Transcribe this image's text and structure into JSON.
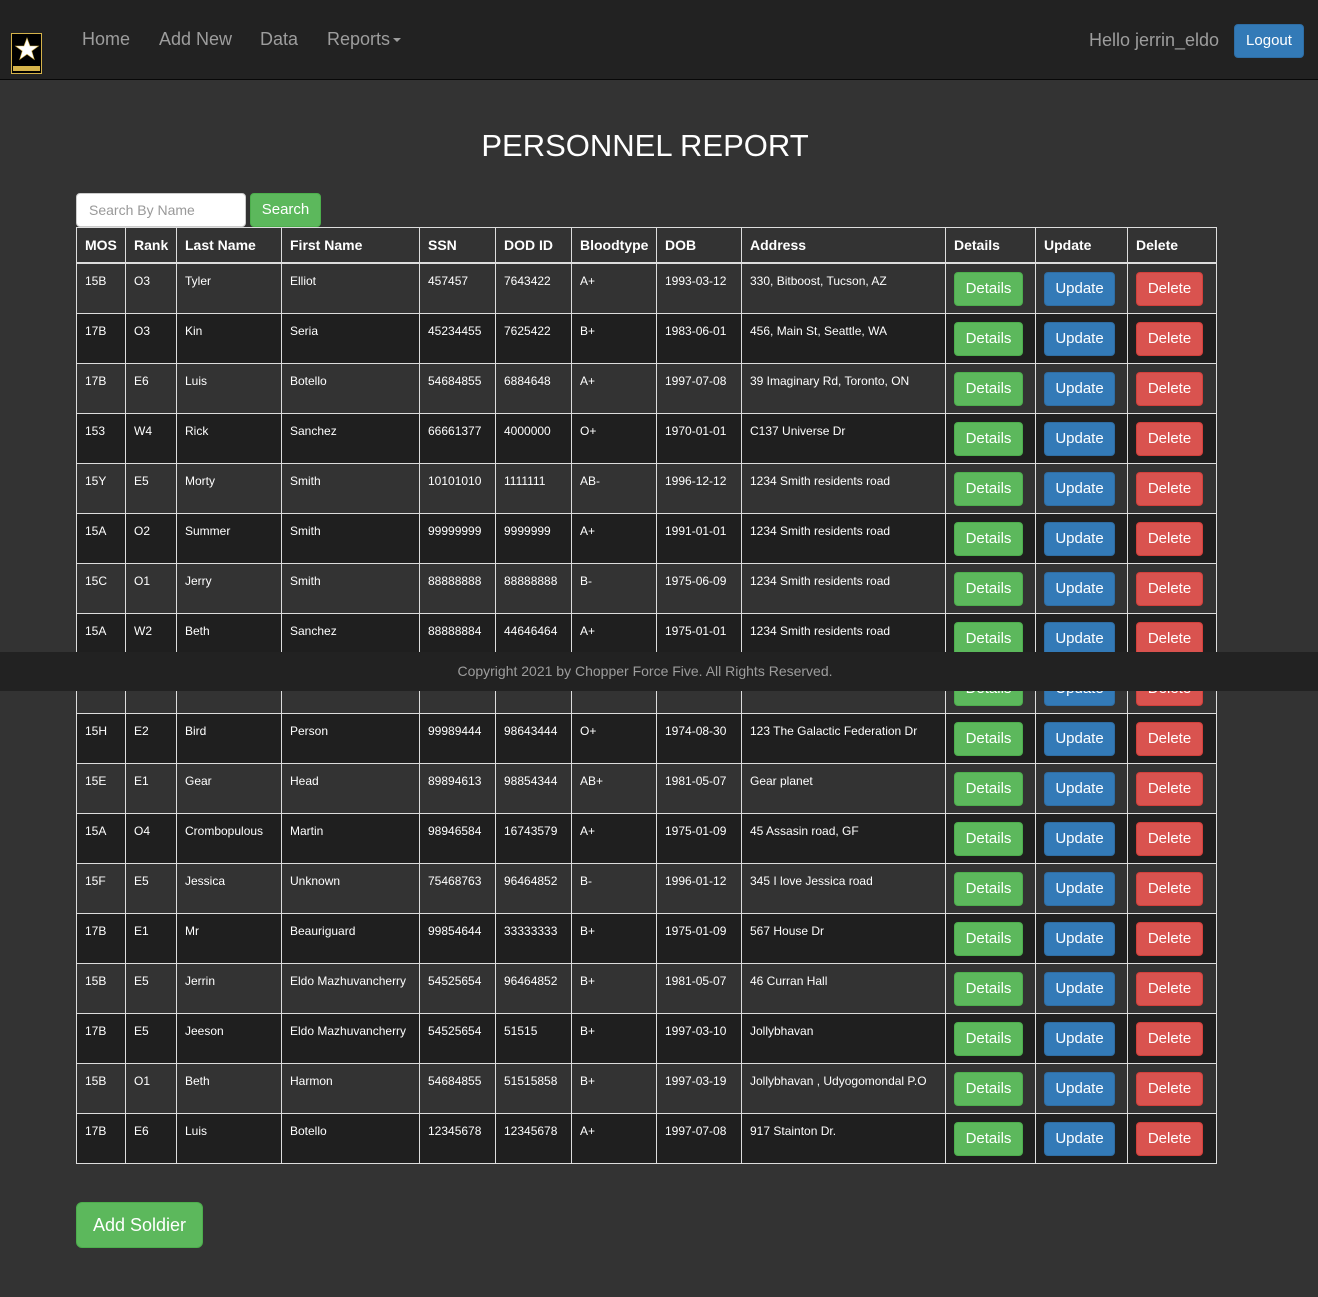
{
  "nav": {
    "links": [
      "Home",
      "Add New",
      "Data"
    ],
    "reports_label": "Reports",
    "greeting": "Hello jerrin_eldo",
    "logout_label": "Logout"
  },
  "page": {
    "title": "PERSONNEL REPORT"
  },
  "search": {
    "placeholder": "Search By Name",
    "button_label": "Search"
  },
  "table": {
    "headers": [
      "MOS",
      "Rank",
      "Last Name",
      "First Name",
      "SSN",
      "DOD ID",
      "Bloodtype",
      "DOB",
      "Address",
      "Details",
      "Update",
      "Delete"
    ],
    "buttons": {
      "details": "Details",
      "update": "Update",
      "delete": "Delete"
    },
    "rows": [
      [
        "15B",
        "O3",
        "Tyler",
        "Elliot",
        "457457",
        "7643422",
        "A+",
        "1993-03-12",
        "330, Bitboost, Tucson, AZ"
      ],
      [
        "17B",
        "O3",
        "Kin",
        "Seria",
        "45234455",
        "7625422",
        "B+",
        "1983-06-01",
        "456, Main St, Seattle, WA"
      ],
      [
        "17B",
        "E6",
        "Luis",
        "Botello",
        "54684855",
        "6884648",
        "A+",
        "1997-07-08",
        "39 Imaginary Rd, Toronto, ON"
      ],
      [
        "153",
        "W4",
        "Rick",
        "Sanchez",
        "66661377",
        "4000000",
        "O+",
        "1970-01-01",
        "C137 Universe Dr"
      ],
      [
        "15Y",
        "E5",
        "Morty",
        "Smith",
        "10101010",
        "1111111",
        "AB-",
        "1996-12-12",
        "1234 Smith residents road"
      ],
      [
        "15A",
        "O2",
        "Summer",
        "Smith",
        "99999999",
        "9999999",
        "A+",
        "1991-01-01",
        "1234 Smith residents road"
      ],
      [
        "15C",
        "O1",
        "Jerry",
        "Smith",
        "88888888",
        "88888888",
        "B-",
        "1975-06-09",
        "1234 Smith residents road"
      ],
      [
        "15A",
        "W2",
        "Beth",
        "Sanchez",
        "88888884",
        "44646464",
        "A+",
        "1975-01-01",
        "1234 Smith residents road"
      ],
      [
        "",
        "",
        "",
        "",
        "",
        "",
        "",
        "",
        ""
      ],
      [
        "15H",
        "E2",
        "Bird",
        "Person",
        "99989444",
        "98643444",
        "O+",
        "1974-08-30",
        "123 The Galactic Federation Dr"
      ],
      [
        "15E",
        "E1",
        "Gear",
        "Head",
        "89894613",
        "98854344",
        "AB+",
        "1981-05-07",
        "Gear planet"
      ],
      [
        "15A",
        "O4",
        "Crombopulous",
        "Martin",
        "98946584",
        "16743579",
        "A+",
        "1975-01-09",
        "45 Assasin road, GF"
      ],
      [
        "15F",
        "E5",
        "Jessica",
        "Unknown",
        "75468763",
        "96464852",
        "B-",
        "1996-01-12",
        "345 I love Jessica road"
      ],
      [
        "17B",
        "E1",
        "Mr",
        "Beauriguard",
        "99854644",
        "33333333",
        "B+",
        "1975-01-09",
        "567 House Dr"
      ],
      [
        "15B",
        "E5",
        "Jerrin",
        "Eldo Mazhuvancherry",
        "54525654",
        "96464852",
        "B+",
        "1981-05-07",
        "46 Curran Hall"
      ],
      [
        "17B",
        "E5",
        "Jeeson",
        "Eldo Mazhuvancherry",
        "54525654",
        "51515",
        "B+",
        "1997-03-10",
        "Jollybhavan"
      ],
      [
        "15B",
        "O1",
        "Beth",
        "Harmon",
        "54684855",
        "51515858",
        "B+",
        "1997-03-19",
        "Jollybhavan , Udyogomondal P.O"
      ],
      [
        "17B",
        "E6",
        "Luis",
        "Botello",
        "12345678",
        "12345678",
        "A+",
        "1997-07-08",
        "917 Stainton Dr."
      ]
    ]
  },
  "footer": {
    "text": "Copyright 2021 by Chopper Force Five. All Rights Reserved."
  },
  "actions": {
    "add_soldier_label": "Add Soldier"
  },
  "colors": {
    "background": "#333333",
    "navbar": "#222222",
    "primary": "#337ab7",
    "success": "#5cb85c",
    "danger": "#d9534f"
  }
}
